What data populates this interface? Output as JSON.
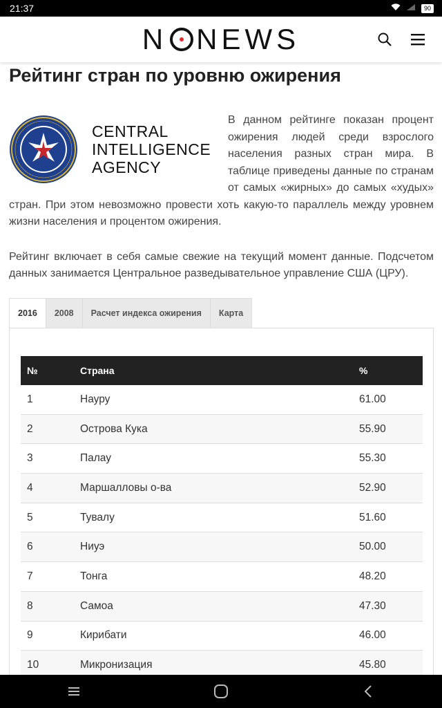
{
  "status": {
    "time": "21:37",
    "battery": "90"
  },
  "header": {
    "logo_left": "N",
    "logo_right": "NEWS"
  },
  "article": {
    "title": "Рейтинг стран по уровню ожирения",
    "cia": {
      "line1": "CENTRAL",
      "line2": "INTELLIGENCE",
      "line3": "AGENCY",
      "seal_text": "CENTRAL INTELLIGENCE AGENCY"
    },
    "para1": "В данном рейтинге показан процент ожирения людей среди взрослого населения разных стран мира. В таблице приведены данные по странам от самых «жирных» до самых «худых» стран. При этом невозможно провести хоть какую-то параллель между уровнем жизни населения и процентом ожирения.",
    "para2": "Рейтинг включает в себя самые свежие на текущий момент данные. Подсчетом данных занимается Центральное разведывательное управление США (ЦРУ)."
  },
  "tabs": [
    {
      "label": "2016",
      "active": true
    },
    {
      "label": "2008",
      "active": false
    },
    {
      "label": "Расчет индекса ожирения",
      "active": false
    },
    {
      "label": "Карта",
      "active": false
    }
  ],
  "table": {
    "headers": [
      "№",
      "Страна",
      "%"
    ],
    "rows": [
      [
        "1",
        "Науру",
        "61.00"
      ],
      [
        "2",
        "Острова Кука",
        "55.90"
      ],
      [
        "3",
        "Палау",
        "55.30"
      ],
      [
        "4",
        "Маршалловы о-ва",
        "52.90"
      ],
      [
        "5",
        "Тувалу",
        "51.60"
      ],
      [
        "6",
        "Ниуэ",
        "50.00"
      ],
      [
        "7",
        "Тонга",
        "48.20"
      ],
      [
        "8",
        "Самоа",
        "47.30"
      ],
      [
        "9",
        "Кирибати",
        "46.00"
      ],
      [
        "10",
        "Микронизация",
        "45.80"
      ]
    ]
  },
  "colors": {
    "logo_accent": "#e8262d",
    "table_header": "#222222",
    "cia_blue": "#1f3f8f",
    "cia_gold": "#d8b531"
  },
  "icons": {
    "search": "search-icon",
    "menu": "hamburger-menu-icon",
    "nav_recent": "recent-apps-icon",
    "nav_home": "home-icon",
    "nav_back": "back-icon"
  }
}
